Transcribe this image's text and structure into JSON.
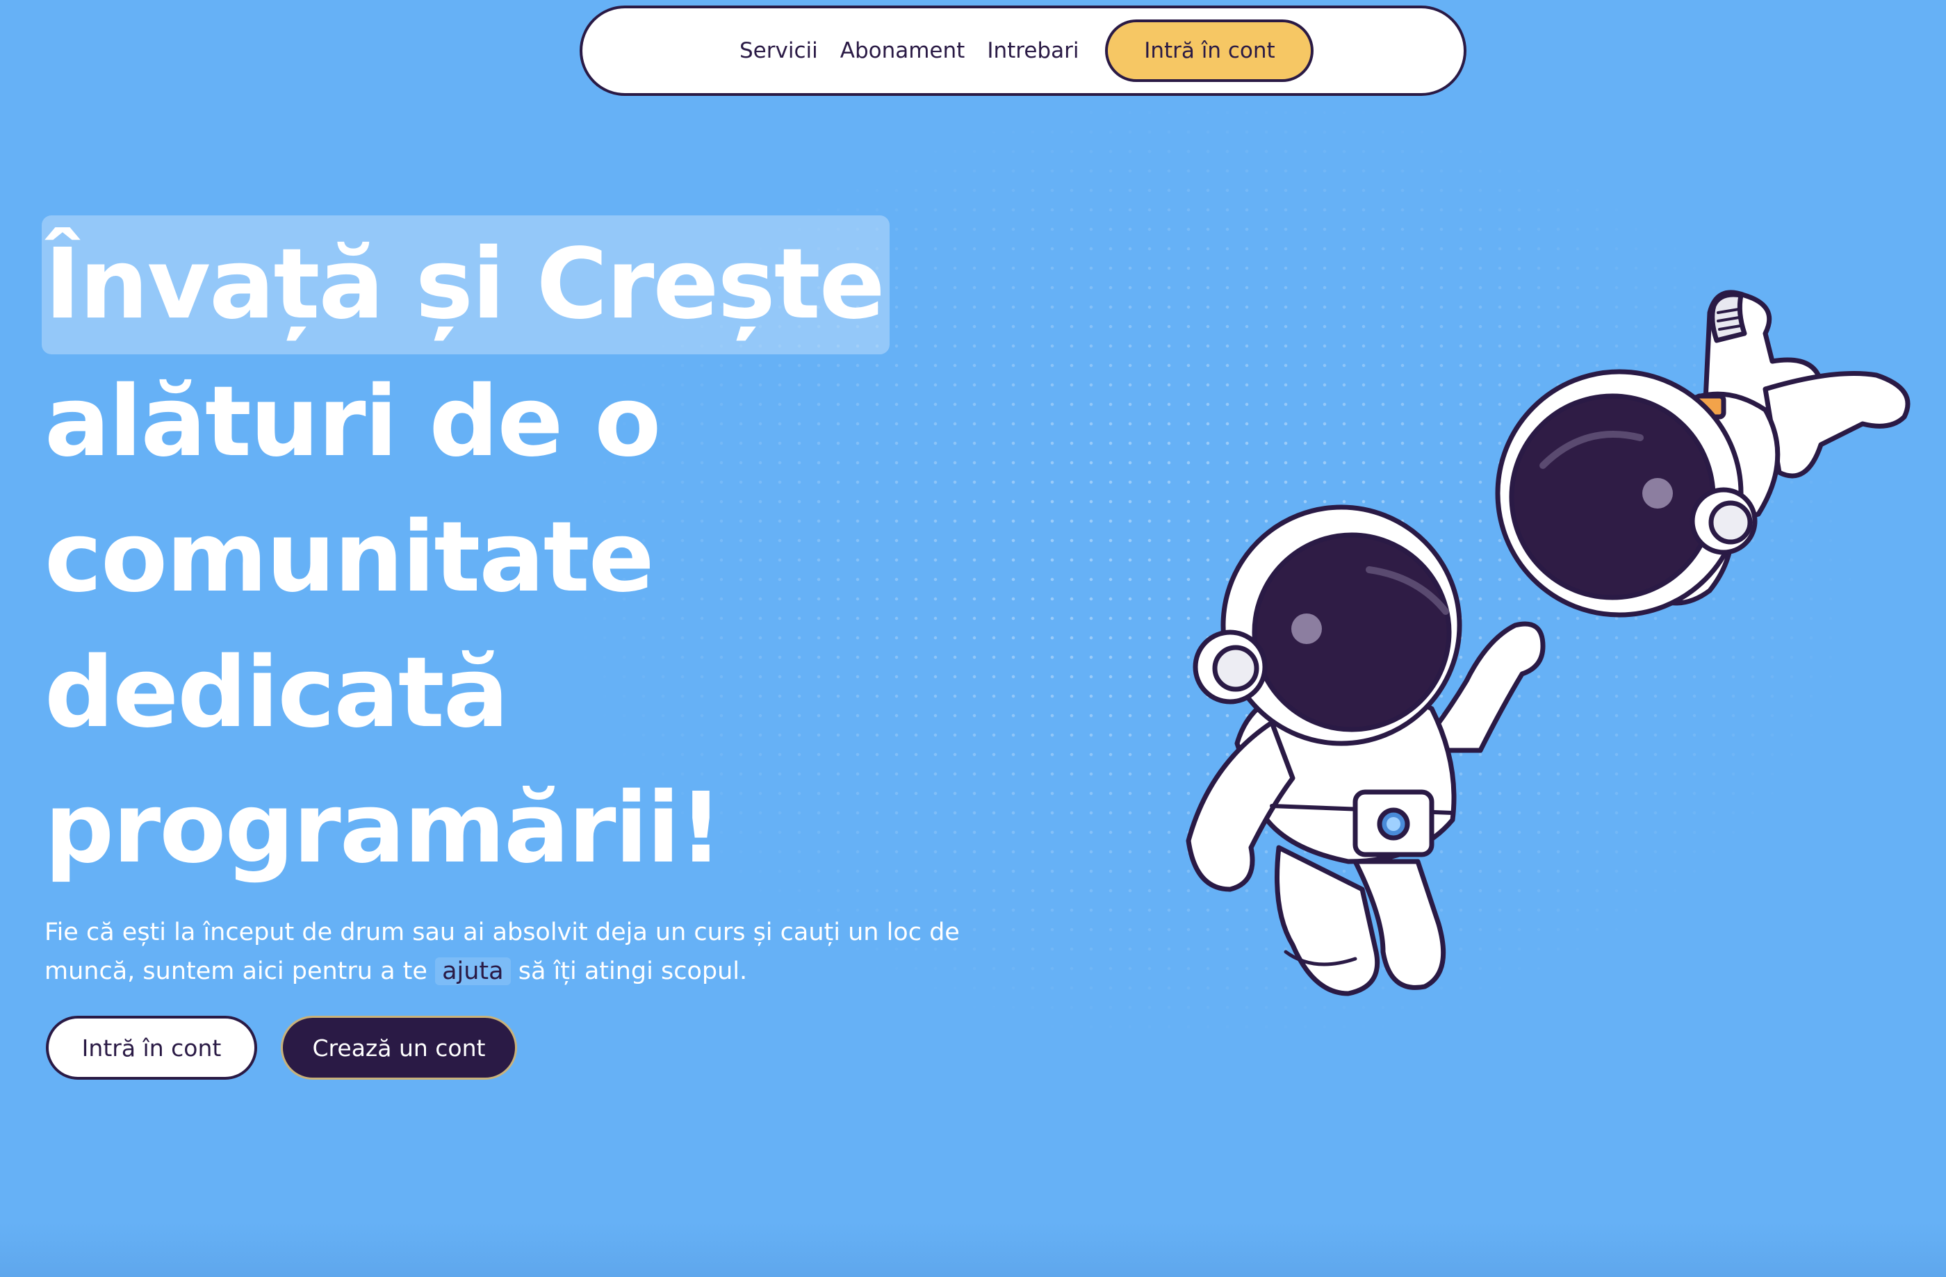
{
  "nav": {
    "links": [
      "Servicii",
      "Abonament",
      "Intrebari"
    ],
    "cta_label": "Intră în cont"
  },
  "hero": {
    "title_highlight": "Învață și Crește",
    "title_lines": [
      "alături de o",
      "comunitate",
      "dedicată",
      "programării!"
    ],
    "subtitle_part1": "Fie că ești la început de drum sau ai absolvit deja un curs și cauți un loc de muncă, suntem aici pentru a te",
    "subtitle_highlight": "ajuta",
    "subtitle_part2": "să îți atingi scopul.",
    "login_button": "Intră în cont",
    "create_button": "Crează un cont"
  },
  "illustration": {
    "subject": "two cartoon astronauts floating, reaching toward each other"
  },
  "colors": {
    "background": "#66b1f6",
    "dark": "#2a1a45",
    "accent_yellow": "#f6c764",
    "white": "#ffffff"
  }
}
